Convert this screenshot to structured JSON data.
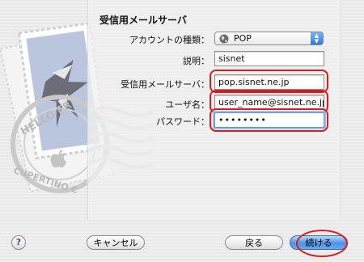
{
  "section": {
    "title": "受信用メールサーバ"
  },
  "account_type": {
    "label": "アカウントの種類：",
    "value": "POP",
    "icon": "globe-icon"
  },
  "description": {
    "label": "説明：",
    "value": "sisnet"
  },
  "incoming_server": {
    "label": "受信用メールサーバ：",
    "value": "pop.sisnet.ne.jp"
  },
  "username": {
    "label": "ユーザ名：",
    "value": "user_name@sisnet.ne.jp"
  },
  "password": {
    "label": "パスワード：",
    "value": "••••••••"
  },
  "stamp": {
    "text_top": "HELLO FR",
    "text_bottom": "CUPERTINO C"
  },
  "buttons": {
    "help": "?",
    "cancel": "キャンセル",
    "back": "戻る",
    "continue": "続ける"
  },
  "colors": {
    "highlight": "#d91c1c",
    "focus": "#5a8fd6",
    "default_button": "#4a92e8"
  }
}
